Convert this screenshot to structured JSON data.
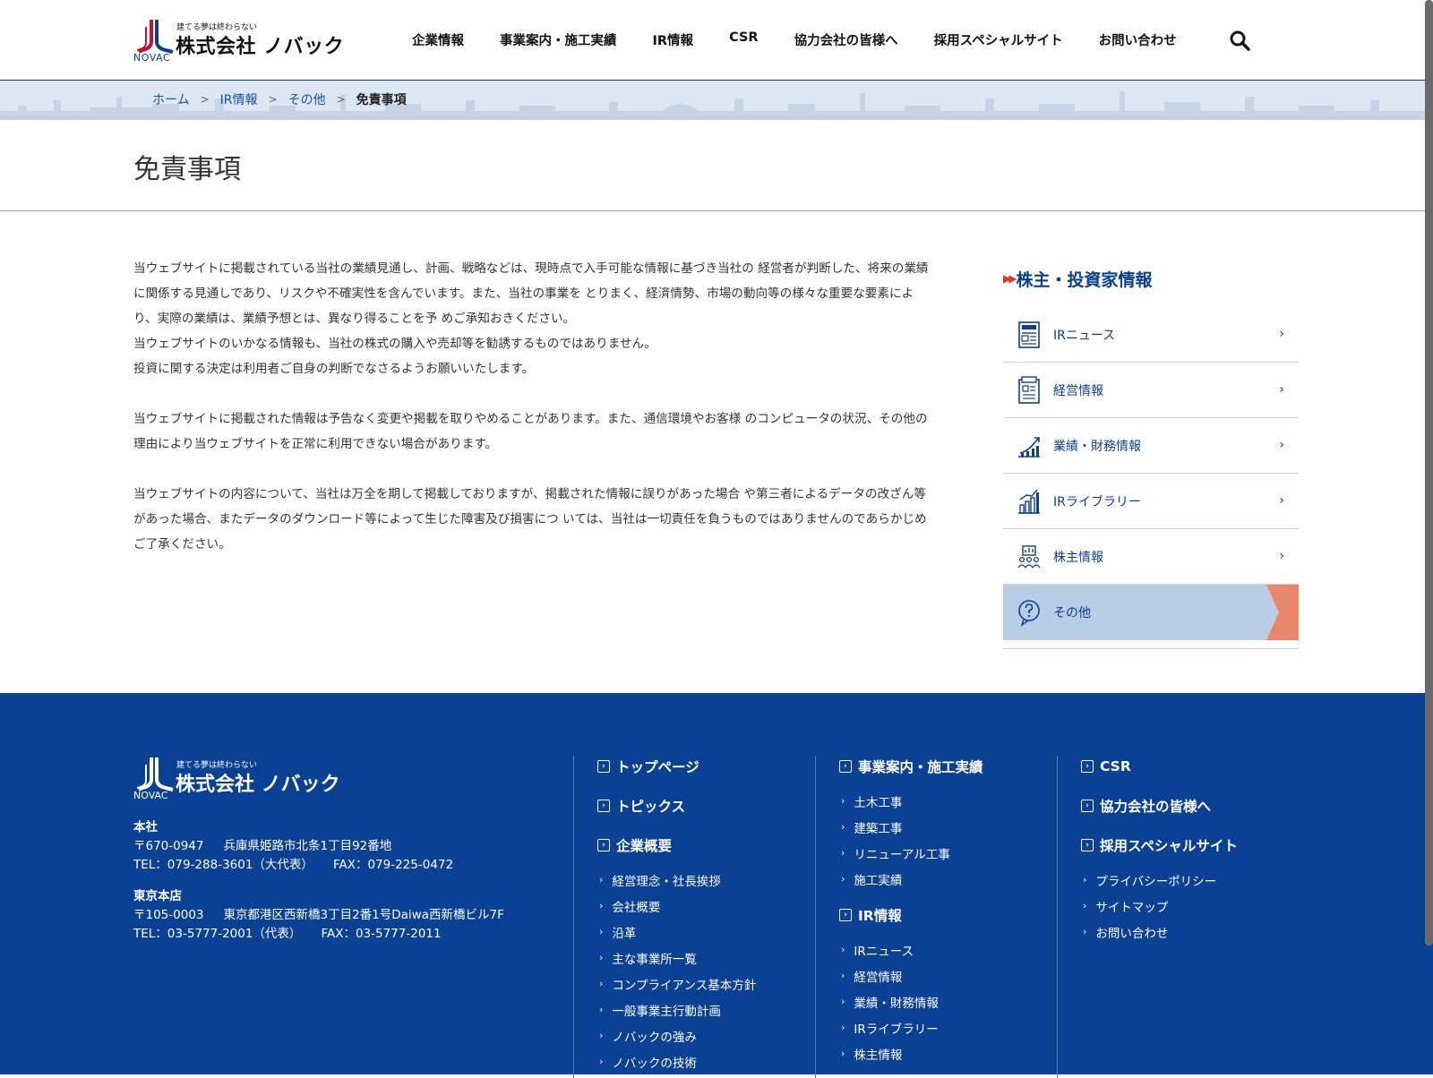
{
  "header": {
    "logo": {
      "tagline": "建てる夢は終わらない",
      "company": "株式会社 ノバック",
      "brand": "NOVAC"
    },
    "nav": [
      "企業情報",
      "事業案内・施工実績",
      "IR情報",
      "CSR",
      "協力会社の皆様へ",
      "採用スペシャルサイト",
      "お問い合わせ"
    ],
    "search_icon": "search-icon"
  },
  "breadcrumb": {
    "items": [
      "ホーム",
      "IR情報",
      "その他"
    ],
    "current": "免責事項"
  },
  "page": {
    "title": "免責事項",
    "paragraphs": [
      [
        "当ウェブサイトに掲載されている当社の業績見通し、計画、戦略などは、現時点で入手可能な情報に基づき当社の 経営者が判断した、将来の業績に関係する見通しであり、リスクや不確実性を含んでいます。また、当社の事業を とりまく、経済情勢、市場の動向等の様々な重要な要素により、実際の業績は、業績予想とは、異なり得ることを予 めご承知おきください。",
        "当ウェブサイトのいかなる情報も、当社の株式の購入や売却等を勧誘するものではありません。",
        "投資に関する決定は利用者ご自身の判断でなさるようお願いいたします。"
      ],
      [
        "当ウェブサイトに掲載された情報は予告なく変更や掲載を取りやめることがあります。また、通信環境やお客様 のコンピュータの状況、その他の理由により当ウェブサイトを正常に利用できない場合があります。"
      ],
      [
        "当ウェブサイトの内容について、当社は万全を期して掲載しておりますが、掲載された情報に誤りがあった場合 や第三者によるデータの改ざん等があった場合、またデータのダウンロード等によって生じた障害及び損害につ いては、当社は一切責任を負うものではありませんのであらかじめご了承ください。"
      ]
    ]
  },
  "side": {
    "heading": "株主・投資家情報",
    "items": [
      {
        "label": "IRニュース",
        "icon": "news-icon"
      },
      {
        "label": "経営情報",
        "icon": "document-icon"
      },
      {
        "label": "業績・財務情報",
        "icon": "growth-chart-icon"
      },
      {
        "label": "IRライブラリー",
        "icon": "bar-chart-icon"
      },
      {
        "label": "株主情報",
        "icon": "shareholders-icon"
      },
      {
        "label": "その他",
        "icon": "question-icon",
        "active": true
      }
    ],
    "active_color": "#b9cde6",
    "flag_color": "#e8876a"
  },
  "footer": {
    "logo": {
      "tagline": "建てる夢は終わらない",
      "company": "株式会社 ノバック",
      "brand": "NOVAC"
    },
    "offices": [
      {
        "name": "本社",
        "postal": "〒670-0947",
        "address": "兵庫県姫路市北条1丁目92番地",
        "tel": "TEL：079-288-3601（大代表）",
        "fax": "FAX：079-225-0472"
      },
      {
        "name": "東京本店",
        "postal": "〒105-0003",
        "address": "東京都港区西新橋3丁目2番1号Daiwa西新橋ビル7F",
        "tel": "TEL：03-5777-2001（代表）",
        "fax": "FAX：03-5777-2011"
      }
    ],
    "col1": {
      "mains": [
        "トップページ",
        "トピックス",
        "企業概要"
      ],
      "subs": [
        "経営理念・社長挨拶",
        "会社概要",
        "沿革",
        "主な事業所一覧",
        "コンプライアンス基本方針",
        "一般事業主行動計画",
        "ノバックの強み",
        "ノバックの技術"
      ]
    },
    "col2": {
      "main1": "事業案内・施工実績",
      "subs1": [
        "土木工事",
        "建築工事",
        "リニューアル工事",
        "施工実績"
      ],
      "main2": "IR情報",
      "subs2": [
        "IRニュース",
        "経営情報",
        "業績・財務情報",
        "IRライブラリー",
        "株主情報"
      ]
    },
    "col3": {
      "mains": [
        "CSR",
        "協力会社の皆様へ",
        "採用スペシャルサイト"
      ],
      "subs": [
        "プライバシーポリシー",
        "サイトマップ",
        "お問い合わせ"
      ]
    },
    "bg_color": "#0a4194"
  }
}
